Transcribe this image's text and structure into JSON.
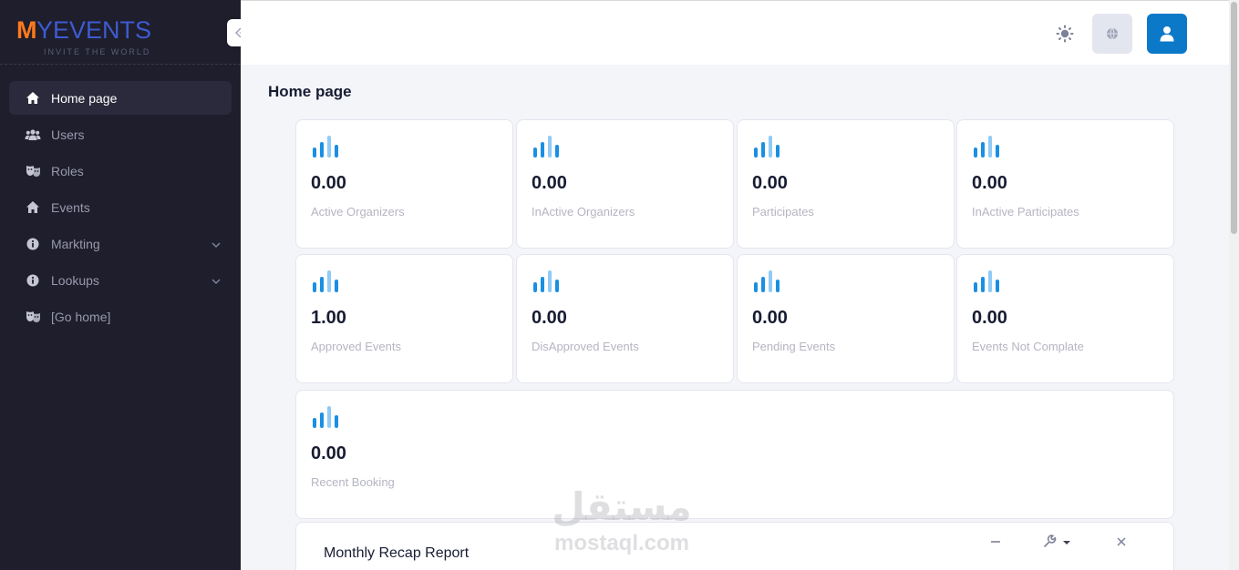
{
  "app": {
    "logo_brand_first": "M",
    "logo_brand_rest": "YEVENTS",
    "logo_tagline": "INVITE THE WORLD"
  },
  "sidebar": {
    "items": [
      {
        "label": "Home page",
        "icon": "home-icon",
        "active": true
      },
      {
        "label": "Users",
        "icon": "users-icon"
      },
      {
        "label": "Roles",
        "icon": "masks-icon"
      },
      {
        "label": "Events",
        "icon": "home-icon"
      },
      {
        "label": "Markting",
        "icon": "info-icon",
        "has_submenu": true
      },
      {
        "label": "Lookups",
        "icon": "info-icon",
        "has_submenu": true
      },
      {
        "label": "[Go home]",
        "icon": "masks-icon"
      }
    ]
  },
  "header": {
    "buttons": [
      "theme-toggle-sun-icon",
      "language-globe-icon",
      "user-profile-icon"
    ]
  },
  "main": {
    "title": "Home page",
    "stats": [
      {
        "value": "0.00",
        "label": "Active Organizers"
      },
      {
        "value": "0.00",
        "label": "InActive Organizers"
      },
      {
        "value": "0.00",
        "label": "Participates"
      },
      {
        "value": "0.00",
        "label": "InActive Participates"
      },
      {
        "value": "1.00",
        "label": "Approved Events"
      },
      {
        "value": "0.00",
        "label": "DisApproved Events"
      },
      {
        "value": "0.00",
        "label": "Pending Events"
      },
      {
        "value": "0.00",
        "label": "Events Not Complate"
      },
      {
        "value": "0.00",
        "label": "Recent Booking"
      }
    ],
    "recap": {
      "title": "Monthly Recap Report"
    }
  },
  "watermark": {
    "arabic": "مستقل",
    "latin": "mostaql.com"
  },
  "colors": {
    "sidebar_bg": "#1e1e2d",
    "accent": "#0b78c8",
    "bar_dark": "#1a8fe3",
    "bar_light": "#8fcbf5"
  }
}
